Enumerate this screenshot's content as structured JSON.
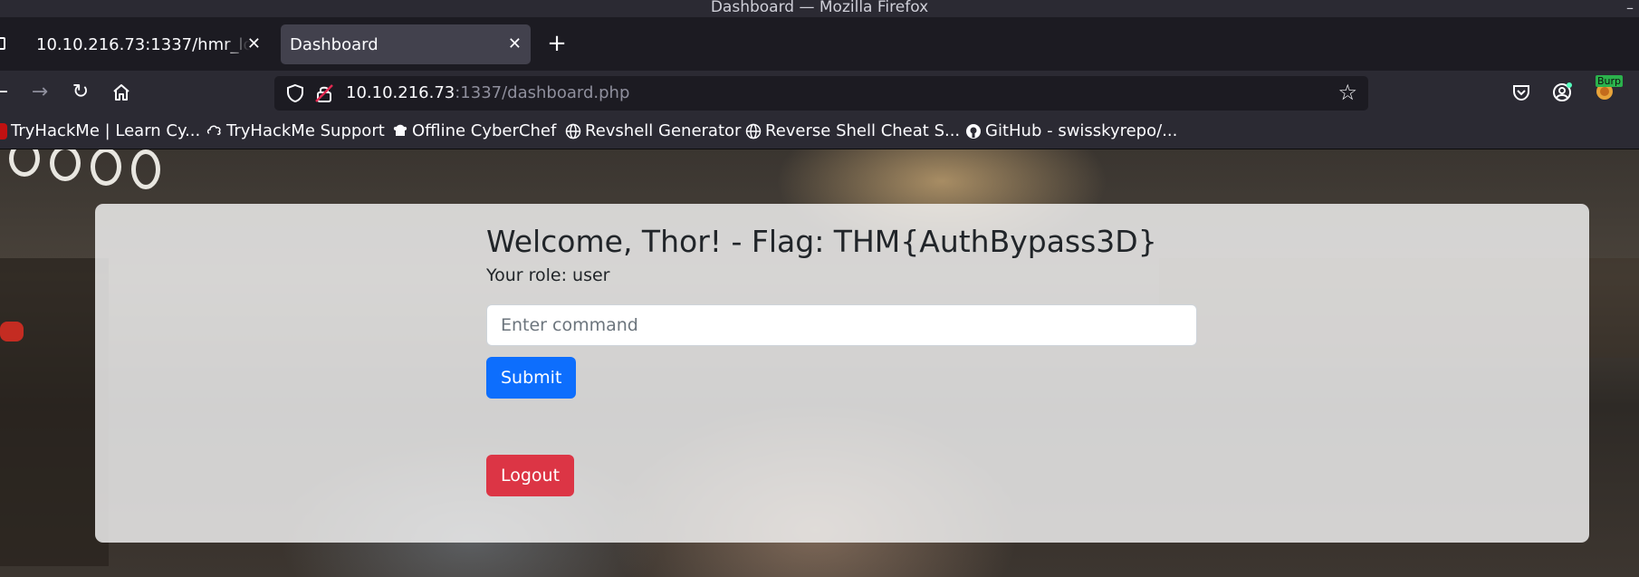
{
  "window": {
    "title": "Dashboard — Mozilla Firefox",
    "control": "–"
  },
  "tabs": [
    {
      "label": "10.10.216.73:1337/hmr_logs",
      "active": false
    },
    {
      "label": "Dashboard",
      "active": true
    }
  ],
  "tab_close_glyph": "✕",
  "new_tab_glyph": "+",
  "nav": {
    "back": "←",
    "forward": "→",
    "reload": "↻"
  },
  "url": {
    "host": "10.10.216.73",
    "rest": ":1337/dashboard.php"
  },
  "bookmarks": [
    {
      "label": "TryHackMe | Learn Cy...",
      "icon": "tryhackme-icon"
    },
    {
      "label": "TryHackMe Support",
      "icon": "support-icon"
    },
    {
      "label": "Offline CyberChef",
      "icon": "chef-icon"
    },
    {
      "label": "Revshell Generator",
      "icon": "globe-icon"
    },
    {
      "label": "Reverse Shell Cheat S...",
      "icon": "globe-icon"
    },
    {
      "label": "GitHub - swisskyrepo/...",
      "icon": "github-icon"
    }
  ],
  "extension_badge": "Burp",
  "dashboard": {
    "heading": "Welcome, Thor! - Flag: THM{AuthBypass3D}",
    "role_text": "Your role: user",
    "command_placeholder": "Enter command",
    "submit_label": "Submit",
    "logout_label": "Logout"
  },
  "colors": {
    "primary": "#0d6efd",
    "danger": "#dc3545",
    "browser_bg": "#1c1b22"
  }
}
